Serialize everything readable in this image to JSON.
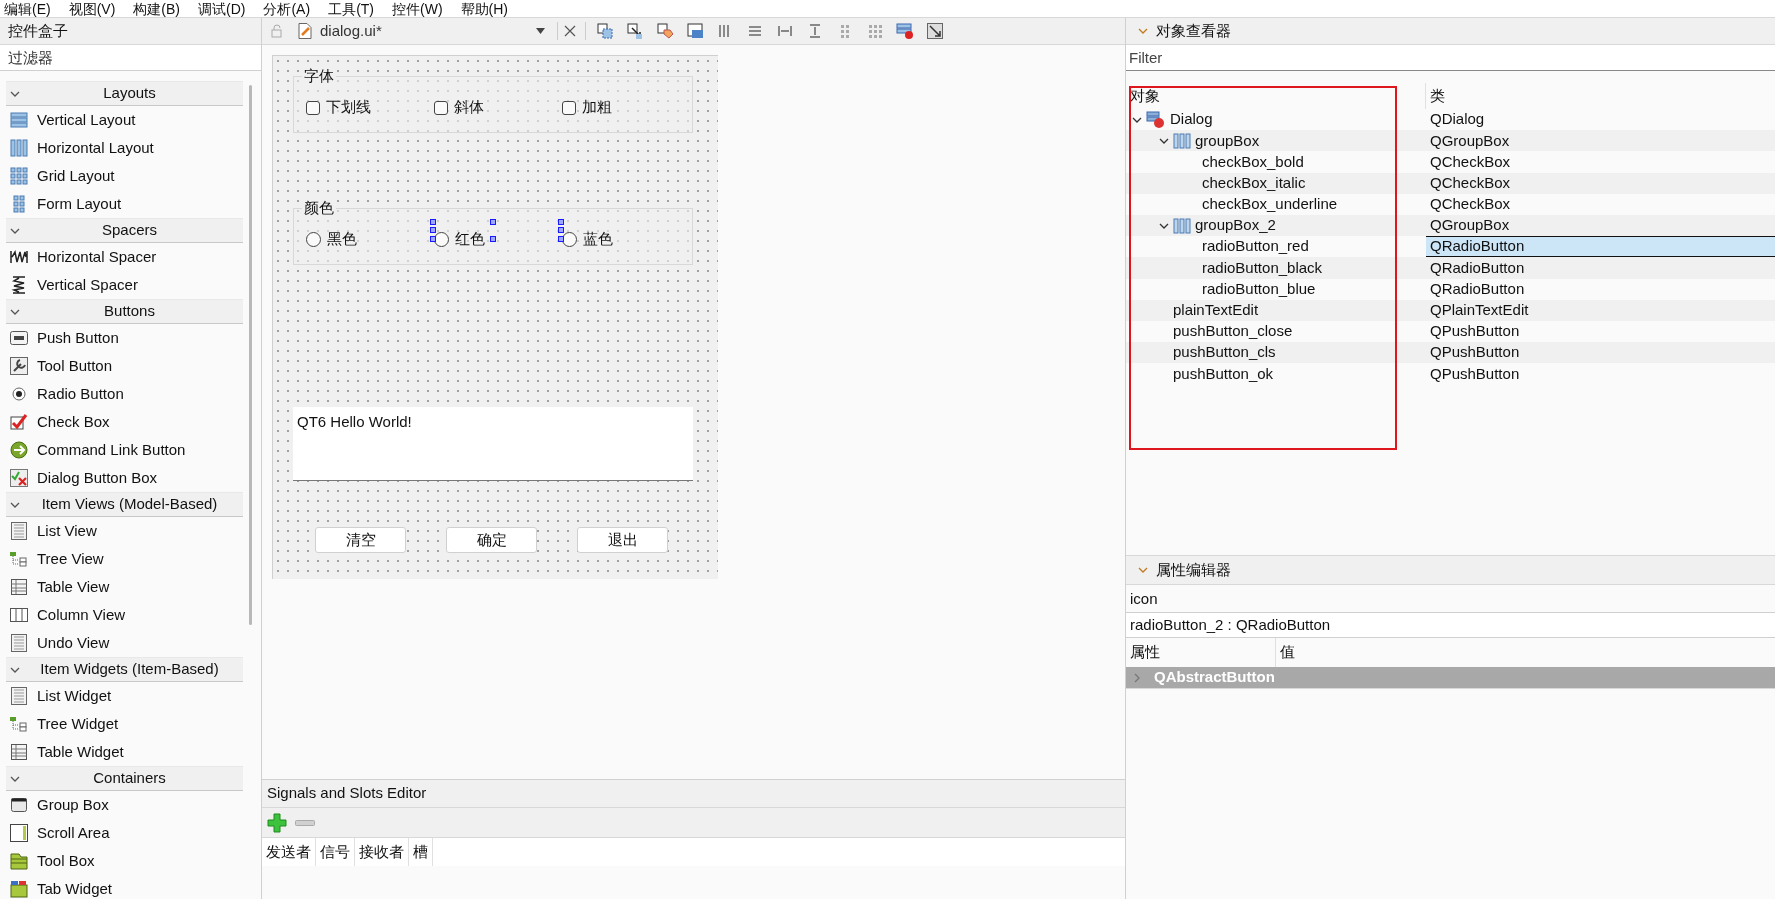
{
  "menu": [
    "编辑(E)",
    "视图(V)",
    "构建(B)",
    "调试(D)",
    "分析(A)",
    "工具(T)",
    "控件(W)",
    "帮助(H)"
  ],
  "widget_box": {
    "title": "控件盒子",
    "filter_placeholder": "过滤器",
    "categories": [
      {
        "name": "Layouts",
        "expanded": true,
        "items": [
          "Vertical Layout",
          "Horizontal Layout",
          "Grid Layout",
          "Form Layout"
        ]
      },
      {
        "name": "Spacers",
        "expanded": true,
        "items": [
          "Horizontal Spacer",
          "Vertical Spacer"
        ]
      },
      {
        "name": "Buttons",
        "expanded": true,
        "items": [
          "Push Button",
          "Tool Button",
          "Radio Button",
          "Check Box",
          "Command Link Button",
          "Dialog Button Box"
        ]
      },
      {
        "name": "Item Views (Model-Based)",
        "expanded": true,
        "items": [
          "List View",
          "Tree View",
          "Table View",
          "Column View",
          "Undo View"
        ]
      },
      {
        "name": "Item Widgets (Item-Based)",
        "expanded": true,
        "items": [
          "List Widget",
          "Tree Widget",
          "Table Widget"
        ]
      },
      {
        "name": "Containers",
        "expanded": true,
        "items": [
          "Group Box",
          "Scroll Area",
          "Tool Box",
          "Tab Widget"
        ]
      }
    ]
  },
  "editor": {
    "tab_title": "dialog.ui*",
    "form": {
      "groups": [
        {
          "title": "字体",
          "items": [
            {
              "kind": "checkbox",
              "label": "下划线",
              "checked": false,
              "selected": false
            },
            {
              "kind": "checkbox",
              "label": "斜体",
              "checked": false,
              "selected": false
            },
            {
              "kind": "checkbox",
              "label": "加粗",
              "checked": false,
              "selected": false
            }
          ]
        },
        {
          "title": "颜色",
          "items": [
            {
              "kind": "radio",
              "label": "黑色",
              "checked": false,
              "selected": false
            },
            {
              "kind": "radio",
              "label": "红色",
              "checked": false,
              "selected": true,
              "right_handles": true
            },
            {
              "kind": "radio",
              "label": "蓝色",
              "checked": false,
              "selected": true,
              "right_handles": false
            }
          ]
        }
      ],
      "text_edit": "QT6 Hello World!",
      "buttons": [
        "清空",
        "确定",
        "退出"
      ]
    }
  },
  "signals_slots": {
    "title": "Signals and Slots Editor",
    "columns": [
      "发送者",
      "信号",
      "接收者",
      "槽"
    ]
  },
  "object_inspector": {
    "title": "对象查看器",
    "filter_placeholder": "Filter",
    "columns": [
      "对象",
      "类"
    ],
    "tree": [
      {
        "name": "Dialog",
        "class": "QDialog",
        "selected": false,
        "expanded": true,
        "children": [
          {
            "name": "groupBox",
            "class": "QGroupBox",
            "selected": false,
            "expanded": true,
            "children": [
              {
                "name": "checkBox_bold",
                "class": "QCheckBox",
                "selected": false
              },
              {
                "name": "checkBox_italic",
                "class": "QCheckBox",
                "selected": false
              },
              {
                "name": "checkBox_underline",
                "class": "QCheckBox",
                "selected": false
              }
            ]
          },
          {
            "name": "groupBox_2",
            "class": "QGroupBox",
            "selected": false,
            "expanded": true,
            "children": [
              {
                "name": "radioButton_red",
                "class": "QRadioButton",
                "selected": true
              },
              {
                "name": "radioButton_black",
                "class": "QRadioButton",
                "selected": false
              },
              {
                "name": "radioButton_blue",
                "class": "QRadioButton",
                "selected": false
              }
            ]
          },
          {
            "name": "plainTextEdit",
            "class": "QPlainTextEdit",
            "selected": false
          },
          {
            "name": "pushButton_close",
            "class": "QPushButton",
            "selected": false
          },
          {
            "name": "pushButton_cls",
            "class": "QPushButton",
            "selected": false
          },
          {
            "name": "pushButton_ok",
            "class": "QPushButton",
            "selected": false
          }
        ]
      }
    ]
  },
  "property_editor": {
    "title": "属性编辑器",
    "filter_value": "icon",
    "object_label": "radioButton_2 : QRadioButton",
    "columns": [
      "属性",
      "值"
    ],
    "groups": [
      {
        "name": "QAbstractButton",
        "expanded": false
      }
    ]
  }
}
